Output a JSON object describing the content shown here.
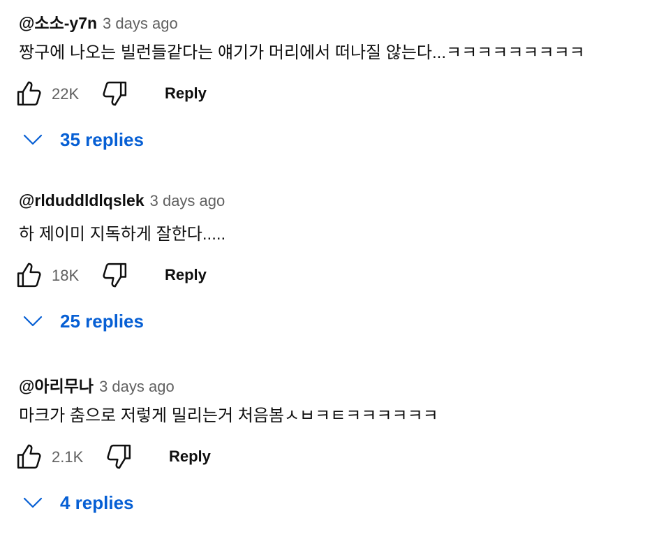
{
  "comments": [
    {
      "author": "@소소-y7n",
      "time": "3 days ago",
      "text": "짱구에 나오는 빌런들같다는 얘기가 머리에서 떠나질 않는다...ㅋㅋㅋㅋㅋㅋㅋㅋㅋ",
      "likes": "22K",
      "reply_label": "Reply",
      "replies_label": "35 replies"
    },
    {
      "author": "@rlduddldlqslek",
      "time": "3 days ago",
      "text": "하 제이미 지독하게 잘한다.....",
      "likes": "18K",
      "reply_label": "Reply",
      "replies_label": "25 replies"
    },
    {
      "author": "@아리무나",
      "time": "3 days ago",
      "text": "마크가 춤으로 저렇게 밀리는거 처음봄ㅅㅂㅋㅌㅋㅋㅋㅋㅋㅋ",
      "likes": "2.1K",
      "reply_label": "Reply",
      "replies_label": "4 replies"
    }
  ],
  "icons": {
    "like": "thumbs-up-outline-icon",
    "dislike": "thumbs-down-outline-icon",
    "expand": "chevron-down-icon"
  },
  "colors": {
    "text": "#0f0f0f",
    "secondary": "#606060",
    "link": "#065fd4"
  }
}
